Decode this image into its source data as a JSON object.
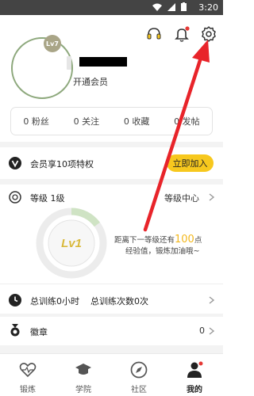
{
  "status_bar": {
    "time": "3:20"
  },
  "profile": {
    "level_badge": "Lv7",
    "vip_text": "开通会员",
    "stats": [
      {
        "count": "0",
        "label": "粉丝"
      },
      {
        "count": "0",
        "label": "关注"
      },
      {
        "count": "0",
        "label": "收藏"
      },
      {
        "count": "0",
        "label": "发帖"
      }
    ]
  },
  "vip": {
    "label": "会员享10项特权",
    "button": "立即加入"
  },
  "level": {
    "title": "等级 1级",
    "center_link": "等级中心",
    "badge": "Lv1",
    "info_prefix": "距离下一等级还有",
    "info_points": "100",
    "info_unit": "点",
    "info_line2": "经验值，锻炼加油哦~",
    "progress": 0.15
  },
  "training": {
    "total_time": "总训练0小时",
    "total_count": "总训练次数0次"
  },
  "badges": {
    "label": "徽章",
    "count": "0"
  },
  "tabs": [
    {
      "label": "锻炼",
      "icon": "heart-pulse-icon"
    },
    {
      "label": "学院",
      "icon": "graduation-cap-icon"
    },
    {
      "label": "社区",
      "icon": "compass-icon"
    },
    {
      "label": "我的",
      "icon": "person-icon"
    }
  ],
  "colors": {
    "accent": "#f7c81e",
    "arrow": "#e8242a",
    "notification_dot": "#e53935",
    "avatar_ring": "#8da87c"
  }
}
